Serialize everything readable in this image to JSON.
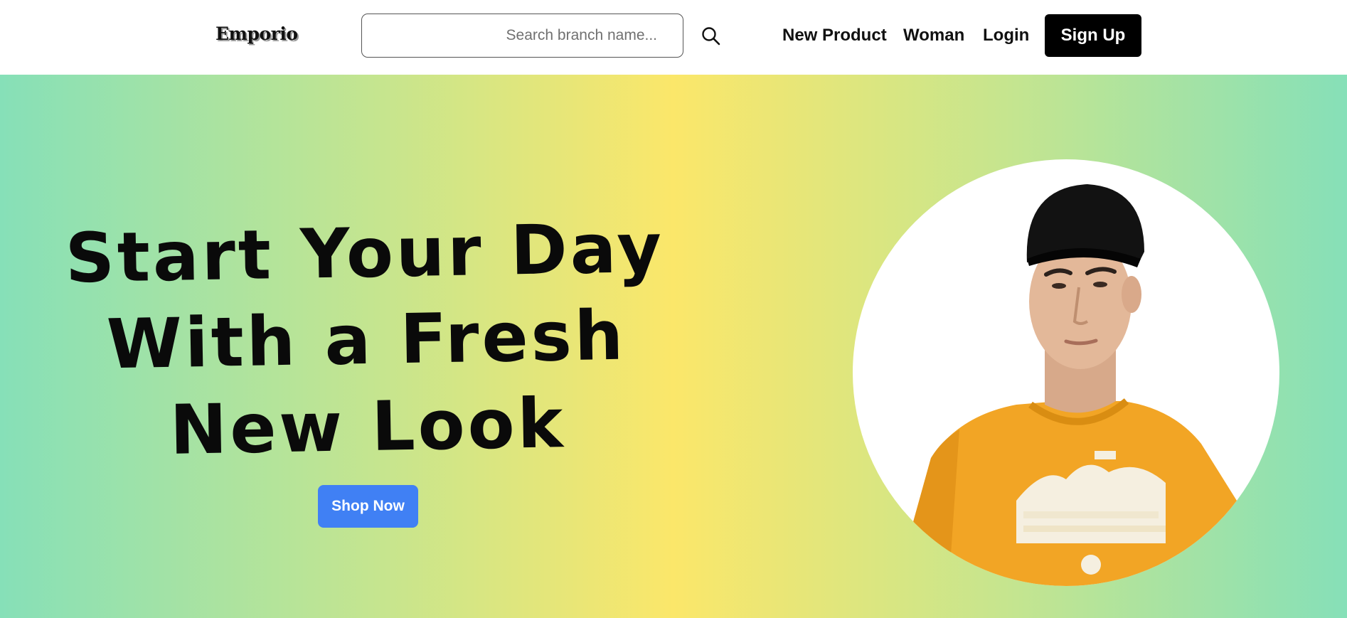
{
  "header": {
    "logo": "Emporio",
    "search": {
      "placeholder": "Search branch name...",
      "icon": "search-icon"
    },
    "nav": {
      "new_product": "New Product",
      "woman": "Woman",
      "login": "Login",
      "sign_up": "Sign Up"
    }
  },
  "hero": {
    "headline_lines": [
      "Start Your Day",
      "With a Fresh",
      "New Look"
    ],
    "cta": "Shop Now",
    "image": "model-wearing-black-cap-and-orange-tshirt"
  },
  "colors": {
    "gradient_edge": "#86e0b8",
    "gradient_center": "#fbe76a",
    "cta": "#4080f4",
    "sign_up_bg": "#000000"
  }
}
